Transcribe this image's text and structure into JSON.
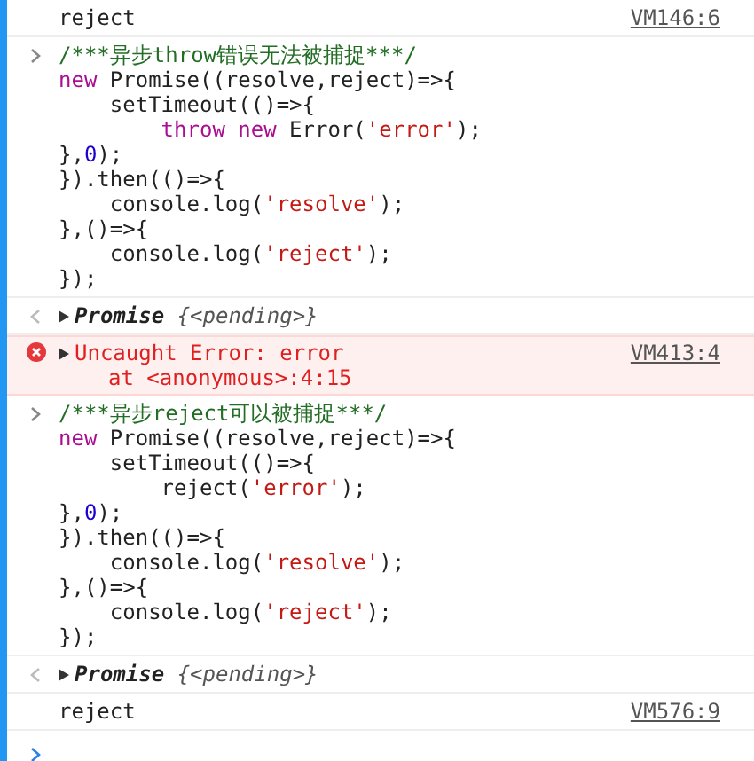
{
  "entries": [
    {
      "kind": "log",
      "text": "reject",
      "source": "VM146:6"
    },
    {
      "kind": "input",
      "lines": [
        [
          {
            "kind": "c",
            "text": "/***异步throw错误无法被捕捉***/"
          }
        ],
        [
          {
            "kind": "k",
            "text": "new"
          },
          {
            "kind": "p",
            "text": " Promise((resolve,reject)=>{"
          }
        ],
        [
          {
            "kind": "p",
            "text": "    setTimeout(()=>{"
          }
        ],
        [
          {
            "kind": "k",
            "text": "        throw new"
          },
          {
            "kind": "p",
            "text": " Error("
          },
          {
            "kind": "s",
            "text": "'error'"
          },
          {
            "kind": "p",
            "text": ");"
          }
        ],
        [
          {
            "kind": "p",
            "text": "},"
          },
          {
            "kind": "n",
            "text": "0"
          },
          {
            "kind": "p",
            "text": ");"
          }
        ],
        [
          {
            "kind": "p",
            "text": "}).then(()=>{"
          }
        ],
        [
          {
            "kind": "p",
            "text": "    console.log("
          },
          {
            "kind": "s",
            "text": "'resolve'"
          },
          {
            "kind": "p",
            "text": ");"
          }
        ],
        [
          {
            "kind": "p",
            "text": "},()=>{"
          }
        ],
        [
          {
            "kind": "p",
            "text": "    console.log("
          },
          {
            "kind": "s",
            "text": "'reject'"
          },
          {
            "kind": "p",
            "text": ");"
          }
        ],
        [
          {
            "kind": "p",
            "text": "});"
          }
        ]
      ]
    },
    {
      "kind": "result",
      "label": "Promise",
      "preview": "{<pending>}"
    },
    {
      "kind": "error",
      "message": "Uncaught Error: error",
      "stack": "at <anonymous>:4:15",
      "source": "VM413:4"
    },
    {
      "kind": "input",
      "lines": [
        [
          {
            "kind": "c",
            "text": "/***异步reject可以被捕捉***/"
          }
        ],
        [
          {
            "kind": "k",
            "text": "new"
          },
          {
            "kind": "p",
            "text": " Promise((resolve,reject)=>{"
          }
        ],
        [
          {
            "kind": "p",
            "text": "    setTimeout(()=>{"
          }
        ],
        [
          {
            "kind": "p",
            "text": "        reject("
          },
          {
            "kind": "s",
            "text": "'error'"
          },
          {
            "kind": "p",
            "text": ");"
          }
        ],
        [
          {
            "kind": "p",
            "text": "},"
          },
          {
            "kind": "n",
            "text": "0"
          },
          {
            "kind": "p",
            "text": ");"
          }
        ],
        [
          {
            "kind": "p",
            "text": "}).then(()=>{"
          }
        ],
        [
          {
            "kind": "p",
            "text": "    console.log("
          },
          {
            "kind": "s",
            "text": "'resolve'"
          },
          {
            "kind": "p",
            "text": ");"
          }
        ],
        [
          {
            "kind": "p",
            "text": "},()=>{"
          }
        ],
        [
          {
            "kind": "p",
            "text": "    console.log("
          },
          {
            "kind": "s",
            "text": "'reject'"
          },
          {
            "kind": "p",
            "text": ");"
          }
        ],
        [
          {
            "kind": "p",
            "text": "});"
          }
        ]
      ]
    },
    {
      "kind": "result",
      "label": "Promise",
      "preview": "{<pending>}"
    },
    {
      "kind": "log",
      "text": "reject",
      "source": "VM576:9"
    },
    {
      "kind": "prompt"
    }
  ]
}
